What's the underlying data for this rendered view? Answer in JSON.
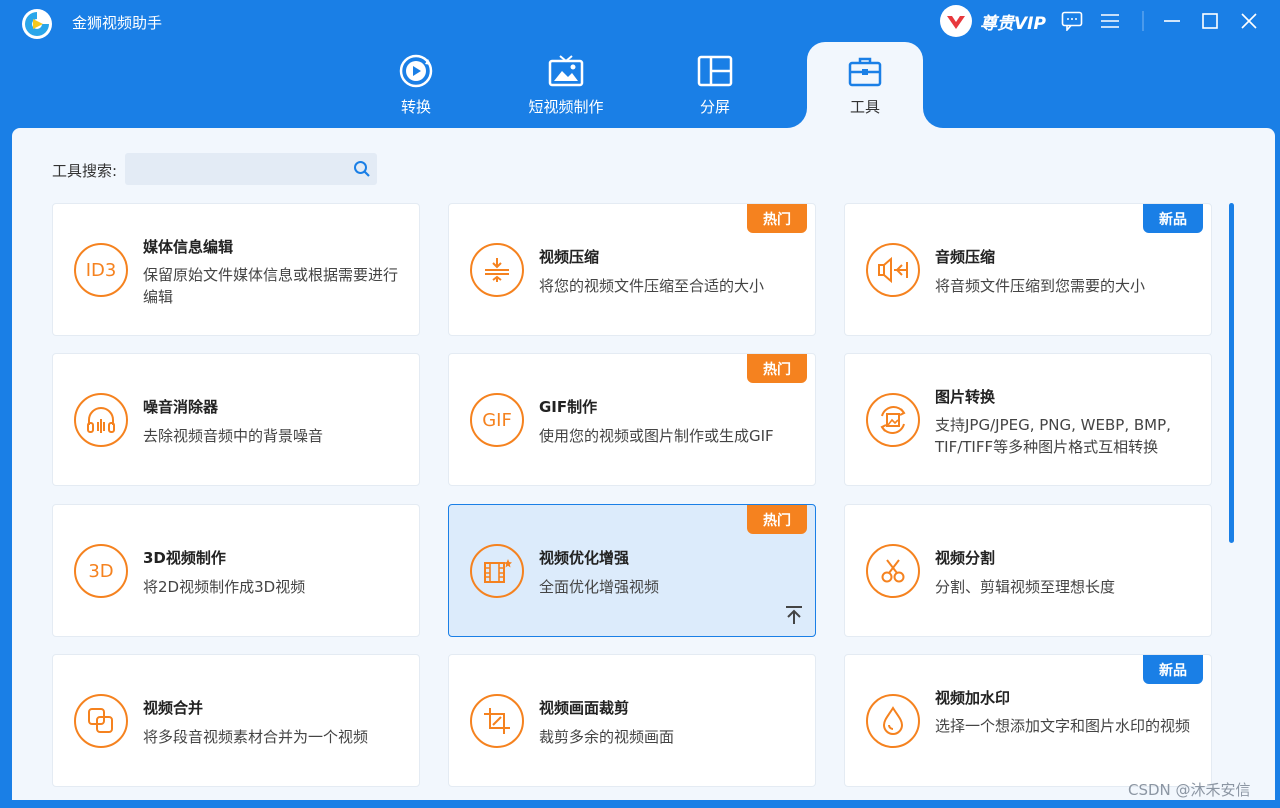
{
  "app": {
    "title": "金狮视频助手"
  },
  "vip": {
    "label": "尊贵VIP"
  },
  "tabs": [
    {
      "label": "转换",
      "icon": "convert-icon",
      "active": false
    },
    {
      "label": "短视频制作",
      "icon": "short-video-icon",
      "active": false
    },
    {
      "label": "分屏",
      "icon": "split-screen-icon",
      "active": false
    },
    {
      "label": "工具",
      "icon": "toolbox-icon",
      "active": true
    }
  ],
  "search": {
    "label": "工具搜索:",
    "value": "",
    "placeholder": ""
  },
  "tools": [
    {
      "title": "媒体信息编辑",
      "desc": "保留原始文件媒体信息或根据需要进行编辑",
      "icon": "id3-icon",
      "icon_text": "ID3",
      "tag": ""
    },
    {
      "title": "视频压缩",
      "desc": "将您的视频文件压缩至合适的大小",
      "icon": "compress-icon",
      "tag": "热门"
    },
    {
      "title": "音频压缩",
      "desc": "将音频文件压缩到您需要的大小",
      "icon": "audio-compress-icon",
      "tag": "新品"
    },
    {
      "title": "噪音消除器",
      "desc": "去除视频音频中的背景噪音",
      "icon": "headphones-icon",
      "tag": ""
    },
    {
      "title": "GIF制作",
      "desc": "使用您的视频或图片制作或生成GIF",
      "icon": "gif-icon",
      "icon_text": "GIF",
      "tag": "热门"
    },
    {
      "title": "图片转换",
      "desc": "支持JPG/JPEG, PNG, WEBP, BMP, TIF/TIFF等多种图片格式互相转换",
      "icon": "image-convert-icon",
      "tag": ""
    },
    {
      "title": "3D视频制作",
      "desc": "将2D视频制作成3D视频",
      "icon": "3d-icon",
      "icon_text": "3D",
      "tag": ""
    },
    {
      "title": "视频优化增强",
      "desc": "全面优化增强视频",
      "icon": "enhance-icon",
      "tag": "热门"
    },
    {
      "title": "视频分割",
      "desc": "分割、剪辑视频至理想长度",
      "icon": "scissors-icon",
      "tag": ""
    },
    {
      "title": "视频合并",
      "desc": "将多段音视频素材合并为一个视频",
      "icon": "merge-icon",
      "tag": ""
    },
    {
      "title": "视频画面裁剪",
      "desc": "裁剪多余的视频画面",
      "icon": "crop-icon",
      "tag": ""
    },
    {
      "title": "视频加水印",
      "desc": "选择一个想添加文字和图片水印的视频",
      "icon": "watermark-drop-icon",
      "tag": "新品"
    }
  ],
  "selected_tool": 7,
  "watermark": "CSDN @沐禾安信",
  "colors": {
    "primary": "#1a7fe6",
    "accent": "#f5821f",
    "content_bg": "#f2f7fd"
  }
}
